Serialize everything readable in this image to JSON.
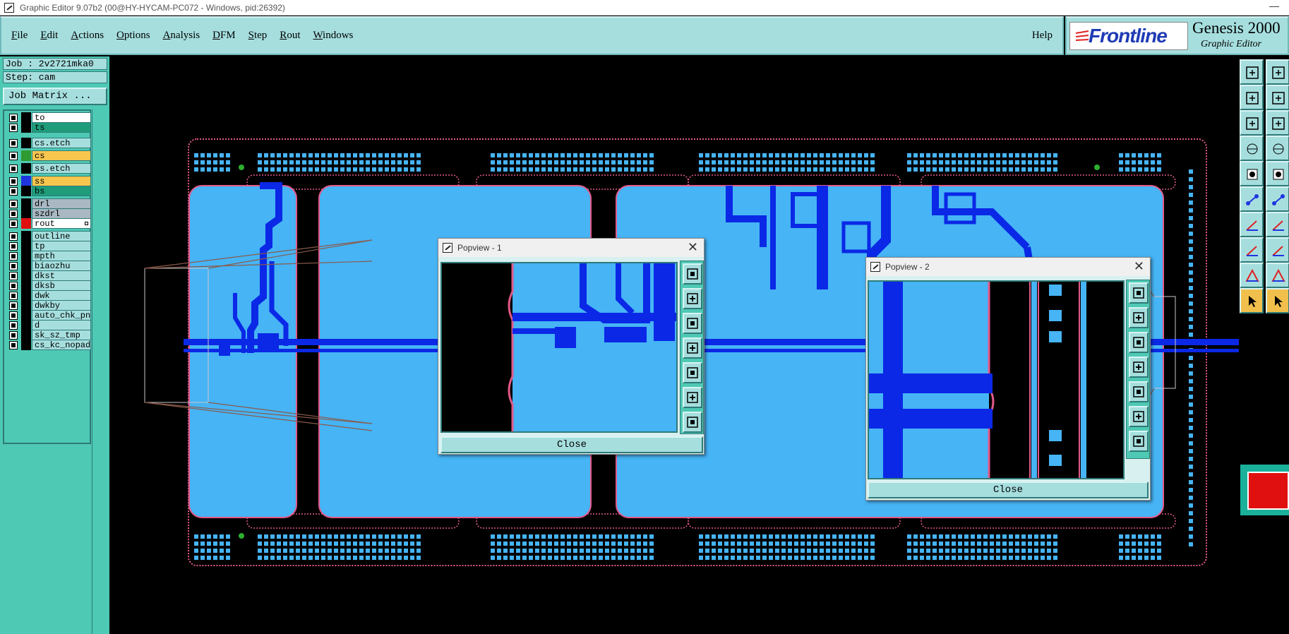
{
  "window": {
    "title": "Graphic Editor 9.07b2 (00@HY-HYCAM-PC072 - Windows, pid:26392)",
    "minimize": "—"
  },
  "menubar": {
    "items": [
      {
        "u": "F",
        "rest": "ile"
      },
      {
        "u": "E",
        "rest": "dit"
      },
      {
        "u": "A",
        "rest": "ctions"
      },
      {
        "u": "O",
        "rest": "ptions"
      },
      {
        "u": "A",
        "rest": "nalysis"
      },
      {
        "u": "D",
        "rest": "FM"
      },
      {
        "u": "S",
        "rest": "tep"
      },
      {
        "u": "R",
        "rest": "out"
      },
      {
        "u": "W",
        "rest": "indows"
      }
    ],
    "help": "Help"
  },
  "logo": {
    "brand": "Frontline",
    "product": "Genesis 2000",
    "subtitle": "Graphic Editor"
  },
  "job": {
    "job_line": "Job : 2v2721mka0",
    "step_line": "Step: cam",
    "job_matrix": "Job Matrix ..."
  },
  "layers": [
    {
      "name": "to",
      "swatch": "#000000",
      "fill": "#ffffff"
    },
    {
      "name": "ts",
      "swatch": "#000000",
      "fill": "#1f9c7a"
    },
    {
      "name": "cs.etch",
      "swatch": "#000000",
      "fill": "#a6dede"
    },
    {
      "name": "cs",
      "swatch": "#2f9a2f",
      "fill": "#f6c64e"
    },
    {
      "name": "ss.etch",
      "swatch": "#000000",
      "fill": "#a6dede"
    },
    {
      "name": "ss",
      "swatch": "#1f35e0",
      "fill": "#f6c64e"
    },
    {
      "name": "bs",
      "swatch": "#000000",
      "fill": "#1f9c7a"
    },
    {
      "name": "drl",
      "swatch": "#000000",
      "fill": "#a9b8c2"
    },
    {
      "name": "szdrl",
      "swatch": "#000000",
      "fill": "#a9b8c2"
    },
    {
      "name": "rout",
      "swatch": "#e01010",
      "fill": "#ffffff"
    },
    {
      "name": "outline",
      "swatch": "#000000",
      "fill": "#a6dede"
    },
    {
      "name": "tp",
      "swatch": "#000000",
      "fill": "#a6dede"
    },
    {
      "name": "mpth",
      "swatch": "#000000",
      "fill": "#a6dede"
    },
    {
      "name": "biaozhu",
      "swatch": "#000000",
      "fill": "#a6dede"
    },
    {
      "name": "dkst",
      "swatch": "#000000",
      "fill": "#a6dede"
    },
    {
      "name": "dksb",
      "swatch": "#000000",
      "fill": "#a6dede"
    },
    {
      "name": "dwk",
      "swatch": "#000000",
      "fill": "#a6dede"
    },
    {
      "name": "dwkby",
      "swatch": "#000000",
      "fill": "#a6dede"
    },
    {
      "name": "auto_chk_pn",
      "swatch": "#000000",
      "fill": "#a6dede"
    },
    {
      "name": "d",
      "swatch": "#000000",
      "fill": "#a6dede"
    },
    {
      "name": "sk_sz_tmp",
      "swatch": "#000000",
      "fill": "#a6dede"
    },
    {
      "name": "cs_kc_nopad",
      "swatch": "#000000",
      "fill": "#a6dede"
    }
  ],
  "popview1": {
    "title": "Popview - 1",
    "close": "Close"
  },
  "popview2": {
    "title": "Popview - 2",
    "close": "Close"
  },
  "colors": {
    "board": "#46b4f5",
    "copper": "#0a28e6",
    "outline": "#e35a8a",
    "panel": "#4ec9b4",
    "button": "#a6dede"
  },
  "toolbar_icons": [
    "zoom-home-icon",
    "snap-icon",
    "zoom-in-icon",
    "zoom-out-icon",
    "zoom-fit-icon",
    "zoom-area-icon",
    "measure-icon",
    "grid-icon",
    "select-icon",
    "route-icon",
    "net-icon",
    "cross-icon",
    "edit-line-icon",
    "edit-line-icon",
    "pad-icon",
    "dim-icon",
    "triangle-icon",
    "triangle-icon",
    "pointer-icon",
    "pointer-icon"
  ]
}
